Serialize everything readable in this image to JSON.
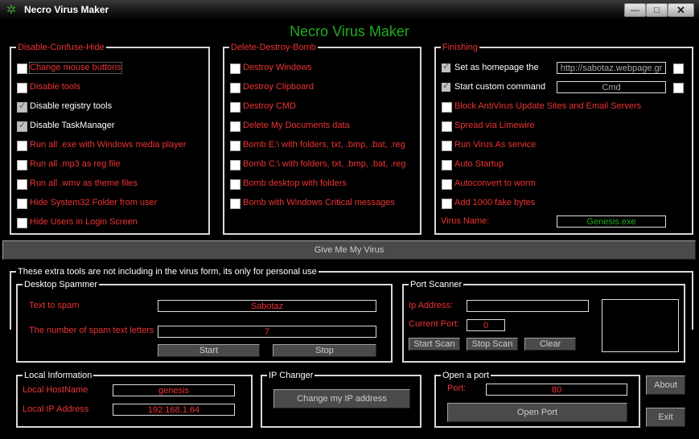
{
  "window": {
    "title": "Necro Virus Maker",
    "minimize": "—",
    "maximize": "□",
    "close": "✕"
  },
  "app_title": "Necro Virus Maker",
  "disable_group": {
    "title": "Disable-Confuse-Hide",
    "items": [
      {
        "label": "Change mouse buttons",
        "checked": false
      },
      {
        "label": "Disable tools",
        "checked": false
      },
      {
        "label": "Disable registry tools",
        "checked": true
      },
      {
        "label": "Disable TaskManager",
        "checked": true
      },
      {
        "label": "Run all .exe with Windows media player",
        "checked": false
      },
      {
        "label": "Run all .mp3 as reg file",
        "checked": false
      },
      {
        "label": "Run all .wmv as theme files",
        "checked": false
      },
      {
        "label": "Hide System32 Folder from user",
        "checked": false
      },
      {
        "label": "Hide Users in Login Screen",
        "checked": false
      }
    ]
  },
  "delete_group": {
    "title": "Delete-Destroy-Bomb",
    "items": [
      {
        "label": "Destroy Windows",
        "checked": false
      },
      {
        "label": "Destroy Clipboard",
        "checked": false
      },
      {
        "label": "Destroy CMD",
        "checked": false
      },
      {
        "label": "Delete My Documents data",
        "checked": false
      },
      {
        "label": "Bomb E:\\ with folders, txt, .bmp, .bat, .reg",
        "checked": false
      },
      {
        "label": "Bomb C:\\ with folders, txt, .bmp, .bat, .reg",
        "checked": false
      },
      {
        "label": "Bomb desktop with folders",
        "checked": false
      },
      {
        "label": "Bomb with Windows Critical messages",
        "checked": false
      }
    ]
  },
  "finishing_group": {
    "title": "Finishing",
    "homepage_label": "Set as homepage the",
    "homepage_value": "http://sabotaz.webpage.gr",
    "custom_cmd_label": "Start custom command",
    "custom_cmd_value": "Cmd",
    "items": [
      {
        "label": "Block AntiVirus Update Sites and Email Servers"
      },
      {
        "label": "Spread via Limewire"
      },
      {
        "label": "Run Virus As service"
      },
      {
        "label": "Auto Startup"
      },
      {
        "label": "Autoconvert to worm"
      },
      {
        "label": "Add 1000  fake bytes"
      }
    ],
    "virus_name_label": "Virus Name:",
    "virus_name_value": "Genesis.exe"
  },
  "give_button": "Give Me My Virus",
  "extra": {
    "title": "These extra tools are not including in the virus form, its only for personal use",
    "spammer": {
      "title": "Desktop Spammer",
      "text_label": "Text to spam",
      "text_value": "Sabotaz",
      "count_label": "The number of spam text letters",
      "count_value": "7",
      "start": "Start",
      "stop": "Stop"
    },
    "port_scanner": {
      "title": "Port Scanner",
      "ip_label": "Ip Address:",
      "ip_value": "",
      "port_label": "Current Port:",
      "port_value": "0",
      "start": "Start Scan",
      "stop": "Stop Scan",
      "clear": "Clear"
    },
    "local_info": {
      "title": "Local Information",
      "host_label": "Local HostName",
      "host_value": "genesis",
      "ip_label": "Local IP Address",
      "ip_value": "192.168.1.64"
    },
    "ip_changer": {
      "title": "IP Changer",
      "button": "Change my IP address"
    },
    "open_port": {
      "title": "Open a port",
      "port_label": "Port:",
      "port_value": "80",
      "button": "Open Port"
    },
    "about": "About",
    "exit": "Exit"
  }
}
